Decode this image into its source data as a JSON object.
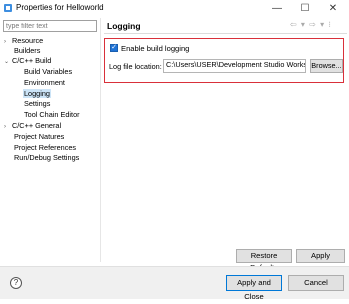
{
  "window": {
    "title": "Properties for Helloworld",
    "minimize": "—",
    "maximize": "☐",
    "close": "✕"
  },
  "filter": {
    "placeholder": "type filter text"
  },
  "tree": {
    "items": [
      {
        "label": "Resource",
        "arrow": "›"
      },
      {
        "label": "Builders",
        "arrow": ""
      },
      {
        "label": "C/C++ Build",
        "arrow": "⌄"
      },
      {
        "label": "Build Variables",
        "arrow": ""
      },
      {
        "label": "Environment",
        "arrow": ""
      },
      {
        "label": "Logging",
        "arrow": ""
      },
      {
        "label": "Settings",
        "arrow": ""
      },
      {
        "label": "Tool Chain Editor",
        "arrow": ""
      },
      {
        "label": "C/C++ General",
        "arrow": "›"
      },
      {
        "label": "Project Natures",
        "arrow": ""
      },
      {
        "label": "Project References",
        "arrow": ""
      },
      {
        "label": "Run/Debug Settings",
        "arrow": ""
      }
    ]
  },
  "page": {
    "title": "Logging",
    "nav": "⇦ ▾ ⇨ ▾ ⁝",
    "enable_label": "Enable build logging",
    "enable_checked": true,
    "checkmark": "✓",
    "location_label": "Log file location:",
    "location_value": "C:\\Users\\USER\\Development Studio Workspace\\.metadata",
    "browse_label": "Browse..."
  },
  "buttons": {
    "restore": "Restore Defaults",
    "apply": "Apply",
    "apply_close": "Apply and Close",
    "cancel": "Cancel",
    "help": "?"
  },
  "colors": {
    "selection": "#cce4f7",
    "highlight_border": "#d9303a",
    "checkbox": "#1f73d6"
  }
}
